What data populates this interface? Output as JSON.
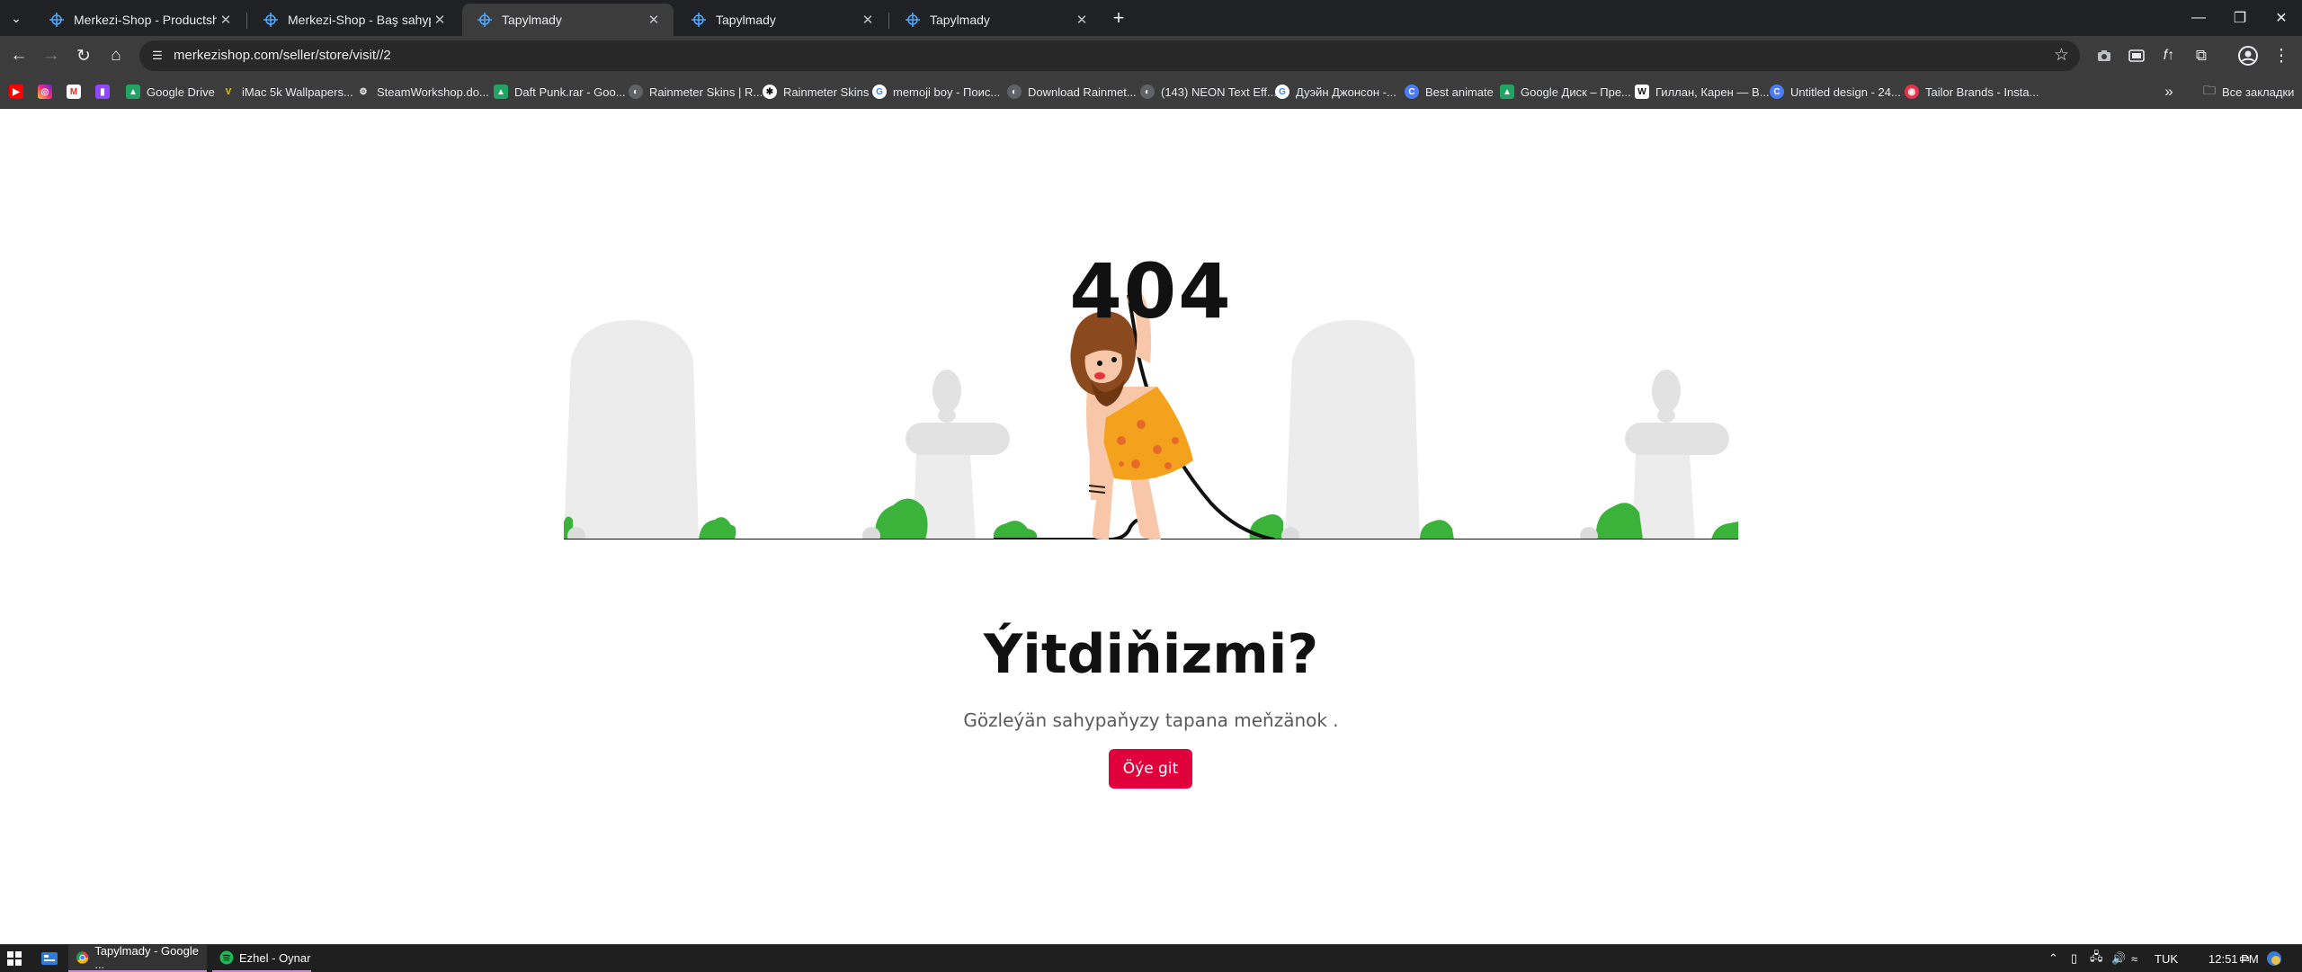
{
  "browser": {
    "tabs": [
      {
        "title": "Merkezi-Shop - Productshli önü",
        "active": false
      },
      {
        "title": "Merkezi-Shop - Baş sahypa",
        "active": false
      },
      {
        "title": "Tapylmady",
        "active": true
      },
      {
        "title": "Tapylmady",
        "active": false
      },
      {
        "title": "Tapylmady",
        "active": false
      }
    ],
    "new_tab_label": "+",
    "address": "merkezishop.com/seller/store/visit//2",
    "bookmarks": [
      {
        "label": "",
        "icon": "youtube-icon"
      },
      {
        "label": "",
        "icon": "instagram-icon"
      },
      {
        "label": "",
        "icon": "gmail-icon"
      },
      {
        "label": "",
        "icon": "twitch-icon"
      },
      {
        "label": "Google Drive",
        "icon": "google-drive-icon"
      },
      {
        "label": "iMac 5k Wallpapers...",
        "icon": "v-icon"
      },
      {
        "label": "SteamWorkshop.do...",
        "icon": "steam-icon"
      },
      {
        "label": "Daft Punk.rar - Goo...",
        "icon": "google-drive-icon"
      },
      {
        "label": "Rainmeter Skins | R...",
        "icon": "globe-icon"
      },
      {
        "label": "Rainmeter Skins",
        "icon": "rainmeter-icon"
      },
      {
        "label": "memoji boy - Поис...",
        "icon": "google-icon"
      },
      {
        "label": "Download Rainmet...",
        "icon": "globe-icon"
      },
      {
        "label": "(143) NEON Text Eff...",
        "icon": "globe-icon"
      },
      {
        "label": "Дуэйн Джонсон -...",
        "icon": "google-icon"
      },
      {
        "label": "Best animate",
        "icon": "canva-icon"
      },
      {
        "label": "Google Диск – Пре...",
        "icon": "google-drive-icon"
      },
      {
        "label": "Гиллан, Карен — В...",
        "icon": "wikipedia-icon"
      },
      {
        "label": "Untitled design - 24...",
        "icon": "canva-icon"
      },
      {
        "label": "Tailor Brands - Insta...",
        "icon": "tailor-brands-icon"
      }
    ],
    "all_bookmarks_label": "Все закладки"
  },
  "page": {
    "code": "404",
    "headline": "Ýitdiňizmi?",
    "message": "Gözleýän sahypaňyzy tapana meňzänok .",
    "button_label": "Öýe git"
  },
  "taskbar": {
    "tasks": [
      {
        "label": "Tapylmady - Google ...",
        "icon": "chrome-icon"
      },
      {
        "label": "Ezhel - Oynar",
        "icon": "spotify-icon"
      }
    ],
    "language": "TUK",
    "time": "12:51 PM"
  },
  "colors": {
    "accent": "#e0003b",
    "chrome_dark": "#202124",
    "chrome_toolbar": "#3c3c3c"
  }
}
